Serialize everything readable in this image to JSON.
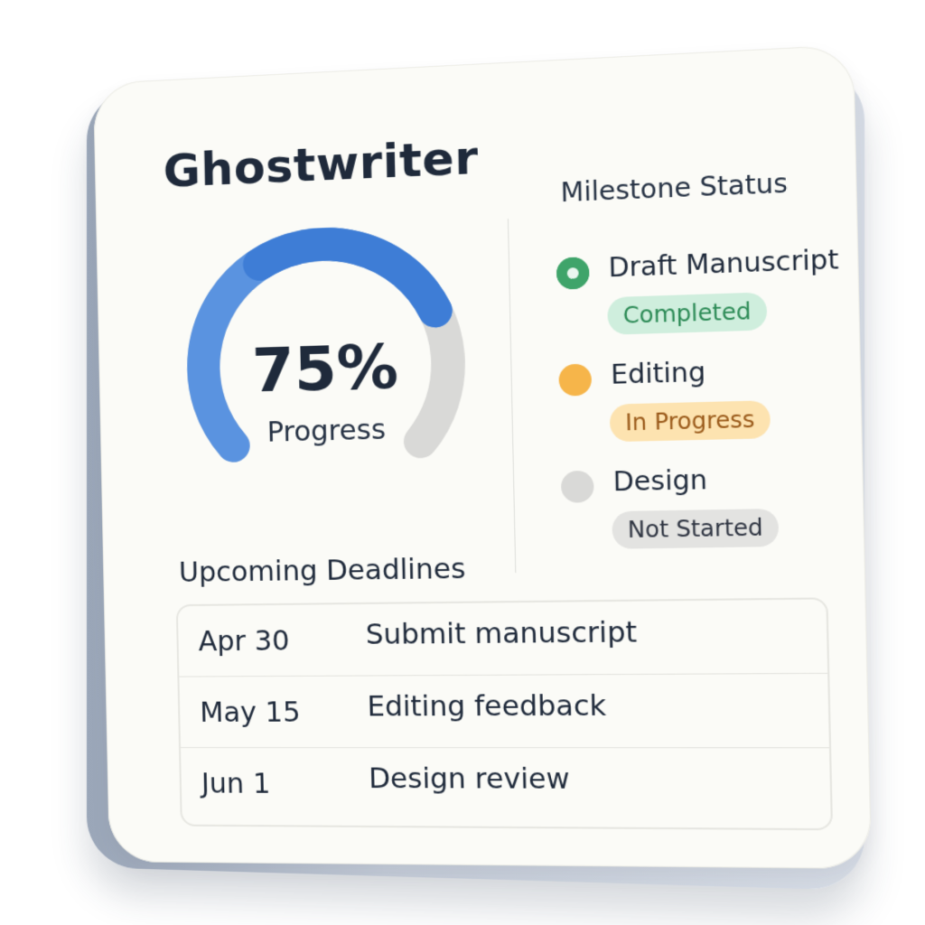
{
  "app": {
    "title": "Ghostwriter"
  },
  "progress": {
    "value": 75,
    "value_label": "75%",
    "label": "Progress",
    "colors": {
      "filled": "#5a93e0",
      "filled_dark": "#3e7dd6",
      "remaining": "#d9d9d7"
    }
  },
  "milestones": {
    "title": "Milestone Status",
    "items": [
      {
        "name": "Draft Manuscript",
        "status": "Completed",
        "icon": "check-circle-icon",
        "color": "#3fa46a"
      },
      {
        "name": "Editing",
        "status": "In Progress",
        "icon": "in-progress-dot-icon",
        "color": "#f6b54a"
      },
      {
        "name": "Design",
        "status": "Not Started",
        "icon": "not-started-dot-icon",
        "color": "#d9d9d7"
      }
    ]
  },
  "deadlines": {
    "title": "Upcoming Deadlines",
    "rows": [
      {
        "date": "Apr 30",
        "task": "Submit manuscript"
      },
      {
        "date": "May 15",
        "task": "Editing feedback"
      },
      {
        "date": "Jun 1",
        "task": "Design review"
      }
    ]
  }
}
